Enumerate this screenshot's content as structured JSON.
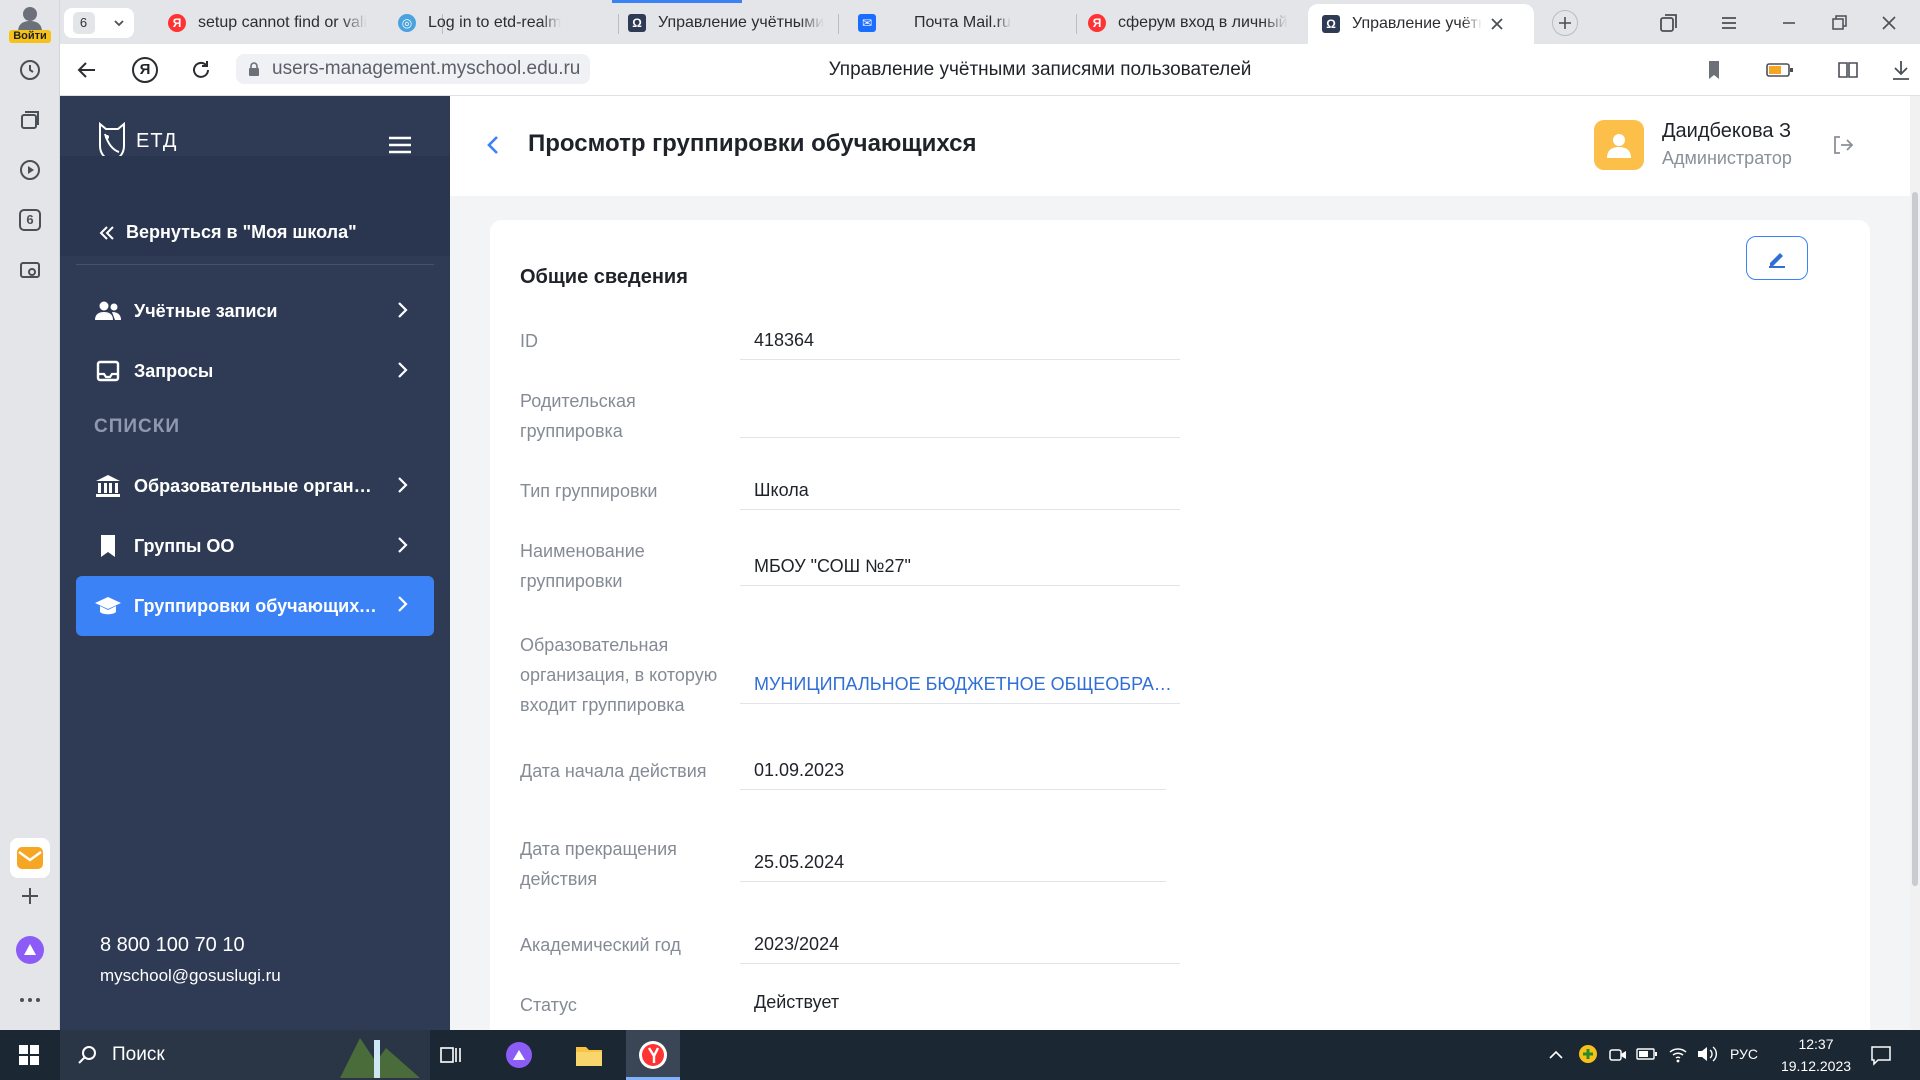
{
  "browser": {
    "login_label": "Войти",
    "tab_counter": "6",
    "tabs": [
      {
        "title": "setup cannot find or vali",
        "icon": "yandex-icon"
      },
      {
        "title": "Log in to etd-realm",
        "icon": "keycloak-icon"
      },
      {
        "title": "Управление учётными",
        "icon": "etd-icon"
      },
      {
        "title": "Почта Mail.ru",
        "icon": "mail-icon"
      },
      {
        "title": "сферум вход в личный",
        "icon": "yandex-icon"
      },
      {
        "title": "Управление учётны",
        "icon": "etd-icon"
      }
    ],
    "url": "users-management.myschool.edu.ru",
    "page_title": "Управление учётными записями пользователей",
    "rail_badge": "6"
  },
  "sidebar": {
    "logo_text": "ЕТД",
    "back_link": "Вернуться в \"Моя школа\"",
    "items": [
      {
        "label": "Учётные записи",
        "icon": "users-icon"
      },
      {
        "label": "Запросы",
        "icon": "inbox-icon"
      }
    ],
    "section_title": "СПИСКИ",
    "list_items": [
      {
        "label": "Образовательные организации",
        "icon": "institution-icon"
      },
      {
        "label": "Группы ОО",
        "icon": "bookmark-icon"
      },
      {
        "label": "Группировки обучающихся",
        "icon": "graduation-cap-icon",
        "active": true
      }
    ],
    "phone": "8 800 100 70 10",
    "email": "myschool@gosuslugi.ru"
  },
  "header": {
    "title": "Просмотр группировки обучающихся",
    "user_name": "Даидбекова З",
    "user_role": "Администратор"
  },
  "card": {
    "section_title": "Общие сведения",
    "fields": [
      {
        "label": "ID",
        "value": "418364"
      },
      {
        "label": "Родительская группировка",
        "value": ""
      },
      {
        "label": "Тип группировки",
        "value": "Школа"
      },
      {
        "label": "Наименование группировки",
        "value": "МБОУ \"СОШ №27\""
      },
      {
        "label": "Образовательная организация, в которую входит группировка",
        "value": "МУНИЦИПАЛЬНОЕ БЮДЖЕТНОЕ ОБЩЕОБРАЗОВАТЕЛЬНОЕ УЧРЕЖДЕНИЕ",
        "link": true
      },
      {
        "label": "Дата начала действия",
        "value": "01.09.2023"
      },
      {
        "label": "Дата прекращения действия",
        "value": "25.05.2024"
      },
      {
        "label": "Академический год",
        "value": "2023/2024"
      },
      {
        "label": "Статус",
        "value": "Действует"
      }
    ]
  },
  "taskbar": {
    "search_label": "Поиск",
    "lang": "РУС",
    "time": "12:37",
    "date": "19.12.2023"
  },
  "colors": {
    "accent": "#3b82f6",
    "sidebar": "#2f3b54",
    "avatar": "#fbbf4a",
    "link": "#2f6fd6"
  }
}
